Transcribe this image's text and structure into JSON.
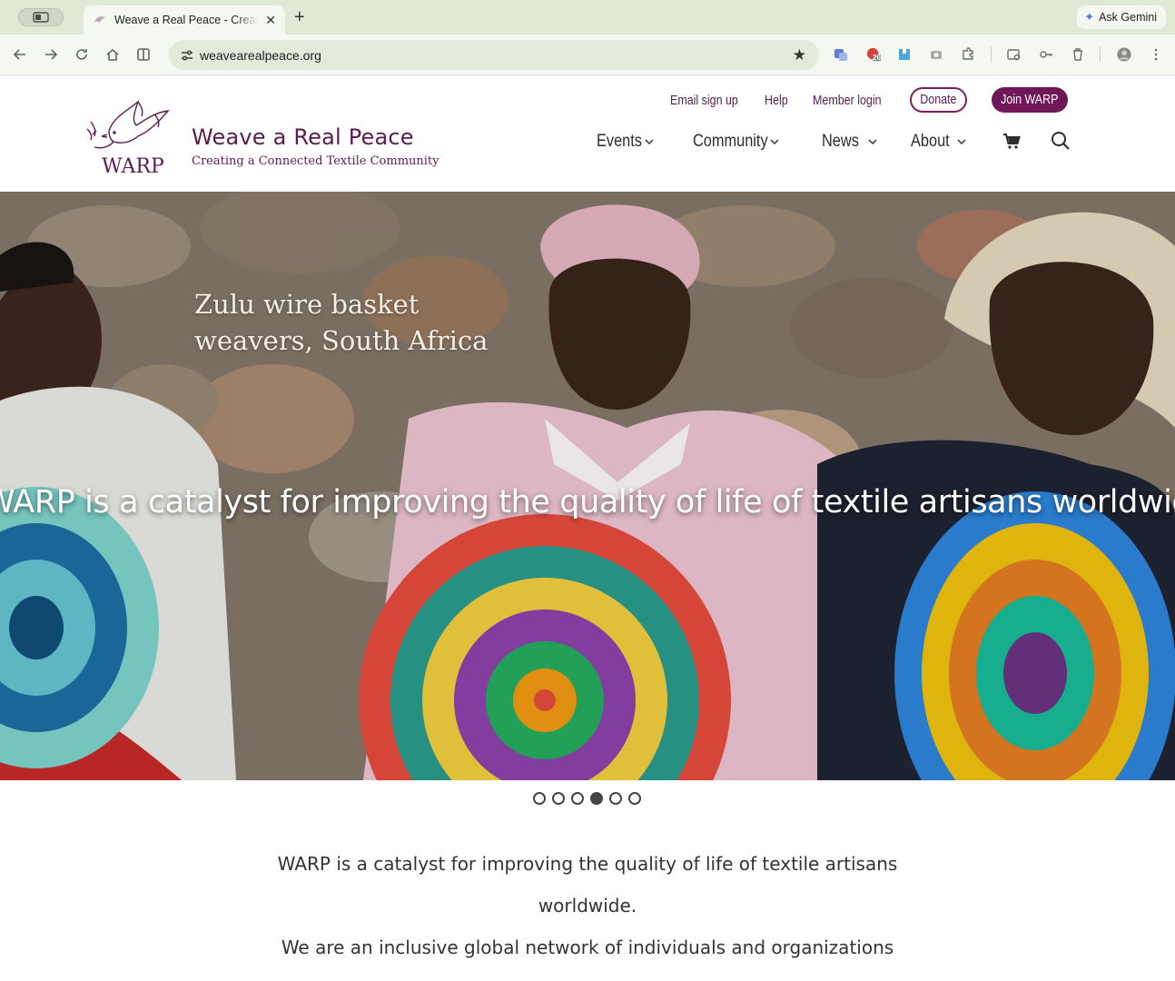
{
  "browser": {
    "tab_title": "Weave a Real Peace - Creating a Connected Textile Community",
    "new_tab": "+",
    "tab_close": "✕",
    "ask_gemini": "Ask Gemini",
    "url": "weavearealpeace.org",
    "extension_badge": "26"
  },
  "header": {
    "site_title": "Weave a Real Peace",
    "tagline": "Creating a Connected Textile Community",
    "logo_text": "WARP",
    "util_links": [
      "Email sign up",
      "Help",
      "Member login"
    ],
    "donate": "Donate",
    "join": "Join WARP",
    "nav": [
      "Events",
      "Community",
      "News",
      "About"
    ]
  },
  "hero": {
    "caption_line1": "Zulu wire basket",
    "caption_line2": "weavers, South Africa",
    "tagline": "WARP is a catalyst for improving the quality of life of textile artisans worldwide.",
    "slide_count": 6,
    "active_slide": 4
  },
  "intro": {
    "para1": "WARP is a catalyst for improving the quality of life of textile artisans worldwide.",
    "para2": "We are an inclusive global network of individuals and organizations"
  },
  "colors": {
    "brand": "#70175a",
    "brand_text": "#5a1d4f",
    "chrome_tabbar": "#dfe9d6",
    "chrome_toolbar": "#f4f8f0"
  }
}
